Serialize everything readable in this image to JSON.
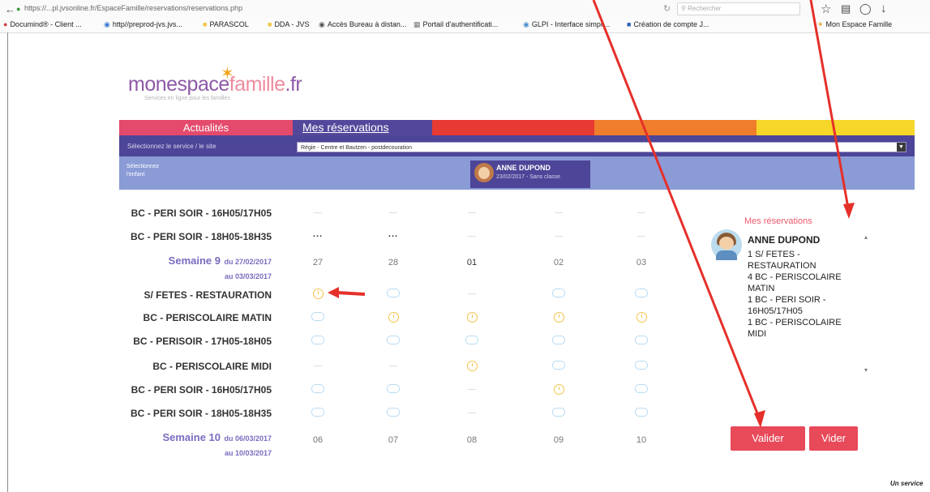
{
  "browser": {
    "url": "https://...pl.jvsonline.fr/EspaceFamille/reservations/reservations.php",
    "search_placeholder": "Rechercher",
    "bookmarks": [
      "Documind® - Client ...",
      "http//preprod-jvs.jvs...",
      "PARASCOL",
      "DDA - JVS",
      "Accès Bureau à distan...",
      "Portail d'authentificati...",
      "GLPI - Interface simpli...",
      "Création de compte J...",
      "Mon Espace Famille"
    ]
  },
  "logo": {
    "part1": "monespace",
    "part2": "famille",
    "part3": ".fr",
    "subtitle": "Services en ligne pour les familles"
  },
  "tabs": {
    "news": "Actualités",
    "reservations": "Mes réservations"
  },
  "service": {
    "label": "Sélectionnez le service / le site",
    "selected": "Régie - Centre et Bautzen - postdecouration"
  },
  "child": {
    "label": "Sélectionnez l'enfant",
    "name": "ANNE DUPOND",
    "sub": "23/02/2017 - Sans classe"
  },
  "grid": {
    "top_rows": [
      "BC - PERI SOIR - 16H05/17H05",
      "BC - PERI SOIR - 18H05-18H35"
    ],
    "week9": {
      "title": "Semaine 9",
      "range1": "du 27/02/2017",
      "range2": "au 03/03/2017",
      "days": [
        "27",
        "28",
        "01",
        "02",
        "03"
      ]
    },
    "rows": [
      {
        "label": "S/ FETES - RESTAURATION",
        "cells": [
          "clock",
          "empty",
          "dash",
          "empty",
          "empty"
        ]
      },
      {
        "label": "BC - PERISCOLAIRE MATIN",
        "cells": [
          "empty",
          "clock",
          "clock",
          "clock",
          "clock"
        ]
      },
      {
        "label": "BC - PERISOIR - 17H05-18H05",
        "cells": [
          "empty",
          "empty",
          "empty",
          "empty",
          "empty"
        ]
      },
      {
        "label": "BC - PERISCOLAIRE MIDI",
        "cells": [
          "dash",
          "dash",
          "clock",
          "empty",
          "empty"
        ]
      },
      {
        "label": "BC - PERI SOIR - 16H05/17H05",
        "cells": [
          "empty",
          "empty",
          "dash",
          "clock",
          "empty"
        ]
      },
      {
        "label": "BC - PERI SOIR - 18H05-18H35",
        "cells": [
          "empty",
          "empty",
          "dash",
          "empty",
          "empty"
        ]
      }
    ],
    "week10": {
      "title": "Semaine 10",
      "range1": "du 06/03/2017",
      "range2": "au 10/03/2017",
      "days": [
        "06",
        "07",
        "08",
        "09",
        "10"
      ]
    },
    "top_dots": "..."
  },
  "panel": {
    "title": "Mes réservations",
    "name": "ANNE DUPOND",
    "items": [
      "1 S/ FETES -",
      "RESTAURATION",
      "4 BC - PERISCOLAIRE",
      "MATIN",
      "1 BC - PERI SOIR -",
      "16H05/17H05",
      "1 BC - PERISCOLAIRE",
      "MIDI"
    ]
  },
  "buttons": {
    "validate": "Valider",
    "clear": "Vider"
  },
  "footer": "Un service",
  "colors": {
    "annotation": "#e5302a",
    "accent": "#e84a5a",
    "nav": "#4d4597"
  }
}
